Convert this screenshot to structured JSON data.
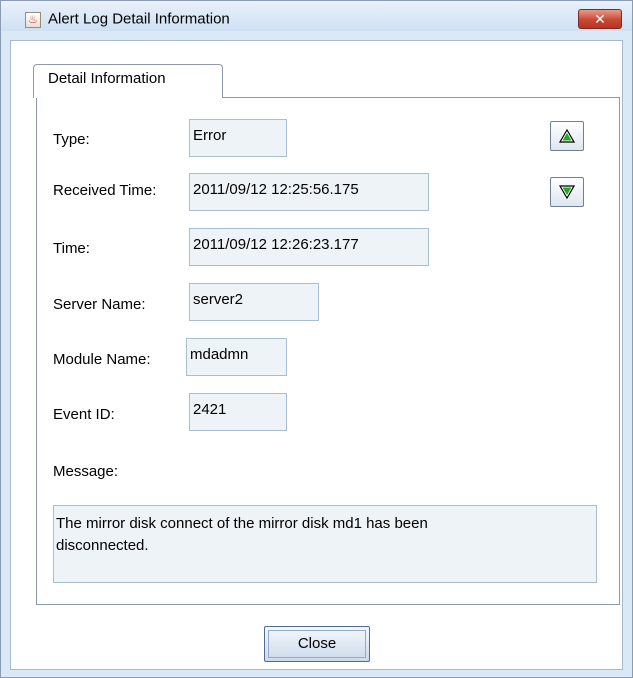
{
  "window": {
    "title": "Alert Log Detail Information",
    "close_glyph": "✕"
  },
  "tabs": [
    {
      "label": "Detail Information",
      "selected": true
    }
  ],
  "details": {
    "type_label": "Type:",
    "type_value": "Error",
    "received_time_label": "Received Time:",
    "received_time_value": "2011/09/12 12:25:56.175",
    "time_label": "Time:",
    "time_value": "2011/09/12 12:26:23.177",
    "server_name_label": "Server Name:",
    "server_name_value": "server2",
    "module_name_label": "Module Name:",
    "module_name_value": "mdadmn",
    "event_id_label": "Event ID:",
    "event_id_value": "2421",
    "message_label": "Message:",
    "message_line1": "The mirror disk connect of the mirror disk md1 has been",
    "message_line2": "disconnected."
  },
  "navigation": {
    "up_icon": "triangle-up-icon",
    "down_icon": "triangle-down-icon",
    "arrow_color": "#22aa22"
  },
  "footer": {
    "close_label": "Close"
  }
}
